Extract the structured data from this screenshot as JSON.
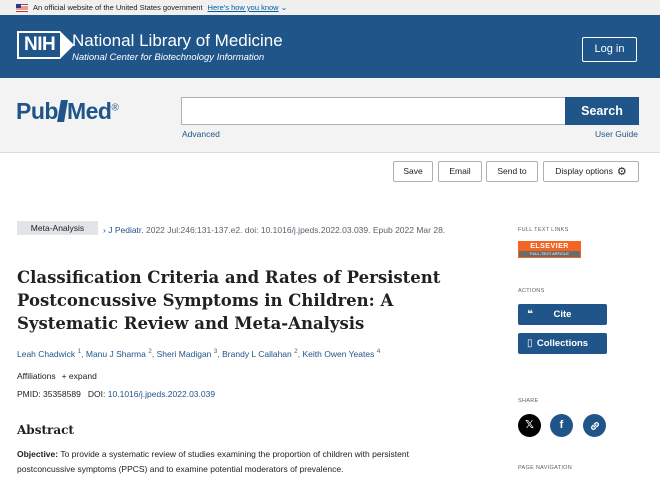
{
  "gov_banner": {
    "text": "An official website of the United States government",
    "link": "Here's how you know"
  },
  "header": {
    "logo": "NIH",
    "title": "National Library of Medicine",
    "subtitle": "National Center for Biotechnology Information",
    "login_label": "Log in"
  },
  "search": {
    "logo_pub": "Pub",
    "logo_med": "Med",
    "logo_reg": "®",
    "placeholder": "",
    "value": "",
    "button_label": "Search",
    "advanced_label": "Advanced",
    "user_guide_label": "User Guide"
  },
  "toolbar": {
    "save": "Save",
    "email": "Email",
    "send_to": "Send to",
    "display_options": "Display options"
  },
  "article": {
    "type_badge": "Meta-Analysis",
    "journal_link": "J Pediatr.",
    "citation": " 2022 Jul:246:131-137.e2. doi: 10.1016/j.jpeds.2022.03.039. Epub 2022 Mar 28.",
    "title": "Classification Criteria and Rates of Persistent Postconcussive Symptoms in Children: A Systematic Review and Meta-Analysis",
    "authors": [
      {
        "name": "Leah Chadwick",
        "sup": "1"
      },
      {
        "name": "Manu J Sharma",
        "sup": "2"
      },
      {
        "name": "Sheri Madigan",
        "sup": "3"
      },
      {
        "name": "Brandy L Callahan",
        "sup": "2"
      },
      {
        "name": "Keith Owen Yeates",
        "sup": "4"
      }
    ],
    "affiliations_label": "Affiliations",
    "expand_label": "+ expand",
    "pmid_label": "PMID:",
    "pmid": "35358589",
    "doi_label": "DOI:",
    "doi": "10.1016/j.jpeds.2022.03.039",
    "abstract_heading": "Abstract",
    "objective_label": "Objective:",
    "objective_text": " To provide a systematic review of studies examining the proportion of children with persistent postconcussive symptoms (PPCS) and to examine potential moderators of prevalence."
  },
  "sidebar": {
    "full_text_heading": "Full text links",
    "elsevier_top": "ELSEVIER",
    "elsevier_bottom": "FULL-TEXT ARTICLE",
    "actions_heading": "Actions",
    "cite_label": "Cite",
    "collections_label": "Collections",
    "share_heading": "Share",
    "page_nav_heading": "Page navigation"
  },
  "colors": {
    "brand_blue": "#20558a",
    "twitter": "#000000",
    "facebook": "#20558a",
    "link": "#20558a"
  }
}
